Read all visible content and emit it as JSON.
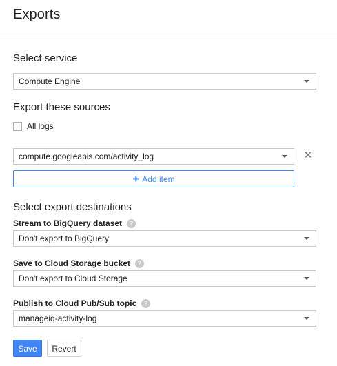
{
  "header": {
    "title": "Exports"
  },
  "service": {
    "heading": "Select service",
    "selected": "Compute Engine"
  },
  "sources": {
    "heading": "Export these sources",
    "all_logs_label": "All logs",
    "all_logs_checked": false,
    "items": [
      {
        "value": "compute.googleapis.com/activity_log"
      }
    ],
    "add_item_label": "Add item"
  },
  "destinations": {
    "heading": "Select export destinations",
    "bigquery": {
      "label": "Stream to BigQuery dataset",
      "selected": "Don't export to BigQuery"
    },
    "storage": {
      "label": "Save to Cloud Storage bucket",
      "selected": "Don't export to Cloud Storage"
    },
    "pubsub": {
      "label": "Publish to Cloud Pub/Sub topic",
      "selected": "manageiq-activity-log"
    }
  },
  "actions": {
    "save_label": "Save",
    "revert_label": "Revert"
  },
  "icons": {
    "help": "help-icon",
    "caret": "caret-down-icon",
    "remove": "close-icon",
    "add": "plus-icon"
  },
  "colors": {
    "accent": "#4285f4"
  }
}
